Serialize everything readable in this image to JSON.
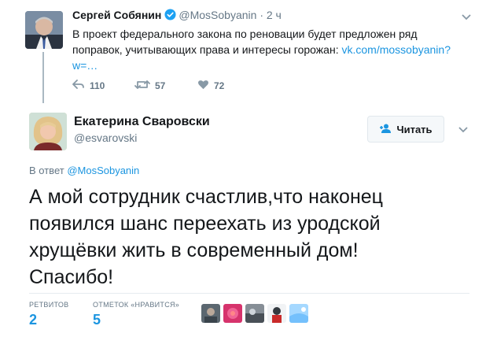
{
  "parent_tweet": {
    "name": "Сергей Собянин",
    "handle": "@MosSobyanin",
    "separator": "·",
    "time": "2 ч",
    "text_line1": "В проект федерального закона по реновации будет предложен ряд",
    "text_line2_prefix": "поправок, учитывающих права и интересы горожан: ",
    "text_line2_link": "vk.com/mossobyanin?",
    "text_line3_link": "w=…",
    "actions": {
      "replies": "110",
      "retweets": "57",
      "likes": "72"
    }
  },
  "main_tweet": {
    "name": "Екатерина Сваровски",
    "handle": "@esvarovski",
    "follow_label": "Читать",
    "reply_prefix": "В ответ ",
    "reply_mention": "@MosSobyanin",
    "text_line1": "А мой сотрудник счастлив,что наконец",
    "text_line2": "появился шанс переехать из уродской",
    "text_line3": "хрущёвки жить в современный дом!",
    "text_line4": "Спасибо!",
    "stats": {
      "retweets_label": "РЕТВИТОВ",
      "retweets_value": "2",
      "likes_label": "ОТМЕТОК «НРАВИТСЯ»",
      "likes_value": "5"
    }
  },
  "colors": {
    "link": "#1b95e0",
    "secondary_text": "#657786",
    "primary_text": "#14171a",
    "verified": "#1da1f2"
  }
}
